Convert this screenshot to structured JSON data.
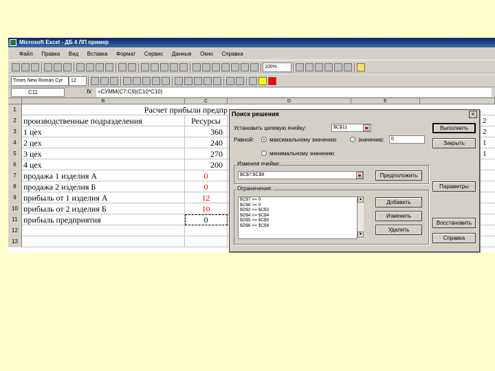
{
  "window": {
    "title": "Microsoft Excel - ДБ 4 ЛП пример"
  },
  "menu": [
    "Файл",
    "Правка",
    "Вид",
    "Вставка",
    "Формат",
    "Сервис",
    "Данные",
    "Окно",
    "Справка"
  ],
  "toolbar": {
    "zoom": "100%"
  },
  "format_toolbar": {
    "font": "Times New Roman Cyr",
    "size": "12"
  },
  "formula_bar": {
    "cell_ref": "C11",
    "fx": "fx",
    "formula": "=СУММ(C7:C9)(C10*C10)"
  },
  "columns": {
    "B": "B",
    "C": "C",
    "D": "D",
    "E": "E"
  },
  "sheet": {
    "title": "Расчет прибыли предпр",
    "rows": [
      {
        "num": "1",
        "b": "",
        "c": ""
      },
      {
        "num": "2",
        "b": "производственные подразделения",
        "c": "Ресурсы"
      },
      {
        "num": "3",
        "b": "1 цех",
        "c": "360"
      },
      {
        "num": "4",
        "b": "2 цех",
        "c": "240"
      },
      {
        "num": "5",
        "b": "3 цех",
        "c": "270"
      },
      {
        "num": "6",
        "b": "4 цех",
        "c": "200"
      },
      {
        "num": "7",
        "b": "продажа 1 изделия А",
        "c": "0"
      },
      {
        "num": "8",
        "b": "продажа 2 изделия Б",
        "c": "0"
      },
      {
        "num": "9",
        "b": "прибыль от 1 изделия А",
        "c": "12"
      },
      {
        "num": "10",
        "b": "прибыль от 2 изделия Б",
        "c": "10"
      },
      {
        "num": "11",
        "b": "прибыль предприятия",
        "c": "0"
      },
      {
        "num": "12",
        "b": "",
        "c": ""
      },
      {
        "num": "13",
        "b": "",
        "c": ""
      }
    ],
    "right_values": [
      "2",
      "2",
      "1",
      "1"
    ]
  },
  "dialog": {
    "title": "Поиск решения",
    "close": "×",
    "target_label": "Установить целевую ячейку:",
    "target_value": "$C$11",
    "equal_label": "Равной:",
    "opt_max": "максимальному значению",
    "opt_value": "значению:",
    "opt_value_field": "0",
    "opt_min": "минимальному значению",
    "changing_label": "Изменяя ячейки:",
    "changing_value": "$C$7:$C$8",
    "guess_button": "Предположить",
    "constraints_label": "Ограничения:",
    "constraints": [
      "$C$7 >= 0",
      "$C$8 >= 0",
      "$D$3 <= $C$3",
      "$D$4 <= $C$4",
      "$D$5 <= $C$5",
      "$D$6 <= $C$6"
    ],
    "add_button": "Добавить",
    "change_button": "Изменить",
    "delete_button": "Удалить",
    "solve_button": "Выполнить",
    "close_button": "Закрыть",
    "options_button": "Параметры",
    "reset_button": "Восстановить",
    "help_button": "Справка"
  }
}
